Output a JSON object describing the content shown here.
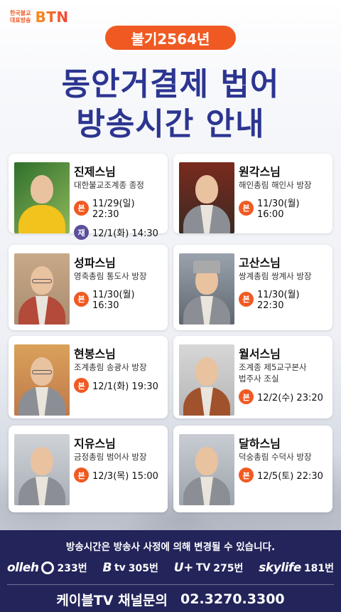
{
  "logo": {
    "line1": "한국불교",
    "line2": "대표방송",
    "brand": "BTN"
  },
  "year": "불기2564년",
  "title": {
    "line1": "동안거결제 법어",
    "line2": "방송시간 안내"
  },
  "colors": {
    "accent": "#f05a22",
    "title": "#2c3590",
    "rerun": "#5b4e9c",
    "footer": "#23245a"
  },
  "badges": {
    "main": "본",
    "rerun": "재"
  },
  "monks": [
    {
      "name": "진제스님",
      "desc": [
        "대한불교조계종 종정"
      ],
      "schedules": [
        {
          "type": "본",
          "time": "11/29(일) 22:30"
        },
        {
          "type": "재",
          "time": "12/1(화) 14:30"
        }
      ]
    },
    {
      "name": "원각스님",
      "desc": [
        "해인총림 해인사 방장"
      ],
      "schedules": [
        {
          "type": "본",
          "time": "11/30(월) 16:00"
        }
      ]
    },
    {
      "name": "성파스님",
      "desc": [
        "영축총림 통도사 방장"
      ],
      "schedules": [
        {
          "type": "본",
          "time": "11/30(월) 16:30"
        }
      ]
    },
    {
      "name": "고산스님",
      "desc": [
        "쌍계총림 쌍계사 방장"
      ],
      "schedules": [
        {
          "type": "본",
          "time": "11/30(월) 22:30"
        }
      ]
    },
    {
      "name": "현봉스님",
      "desc": [
        "조계총림 송광사 방장"
      ],
      "schedules": [
        {
          "type": "본",
          "time": "12/1(화) 19:30"
        }
      ]
    },
    {
      "name": "월서스님",
      "desc": [
        "조계종 제5교구본사",
        "법주사 조실"
      ],
      "schedules": [
        {
          "type": "본",
          "time": "12/2(수) 23:20"
        }
      ]
    },
    {
      "name": "지유스님",
      "desc": [
        "금정총림 범어사 방장"
      ],
      "schedules": [
        {
          "type": "본",
          "time": "12/3(목) 15:00"
        }
      ]
    },
    {
      "name": "달하스님",
      "desc": [
        "덕숭총림 수덕사 방장"
      ],
      "schedules": [
        {
          "type": "본",
          "time": "12/5(토) 22:30"
        }
      ]
    }
  ],
  "footer": {
    "notice": "방송시간은 방송사 사정에 의해 변경될 수 있습니다.",
    "channels": [
      {
        "brand": "olleh",
        "icon": "olleh-o-icon",
        "number": "233번"
      },
      {
        "brand": "B",
        "suffix": "tv",
        "icon": "btv-icon",
        "number": "305번"
      },
      {
        "brand": "U+",
        "suffix": "TV",
        "icon": "uplus-icon",
        "number": "275번"
      },
      {
        "brand": "skylife",
        "icon": "skylife-icon",
        "number": "181번"
      }
    ],
    "cable_label": "케이블TV 채널문의",
    "cable_phone": "02.3270.3300"
  }
}
